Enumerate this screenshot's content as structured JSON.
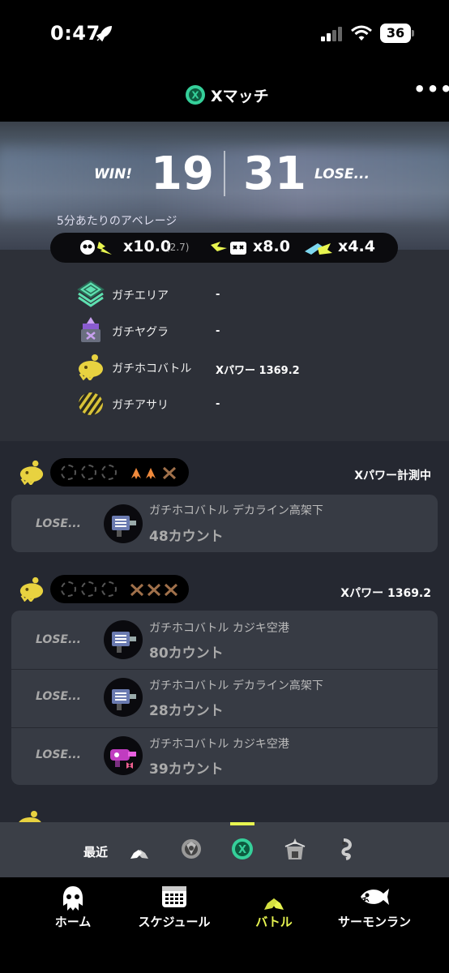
{
  "status_bar": {
    "time": "0:47",
    "battery": "36"
  },
  "header": {
    "title": "Xマッチ",
    "more_label": "•••"
  },
  "score": {
    "win_label": "WIN!",
    "win": "19",
    "lose": "31",
    "lose_label": "LOSE...",
    "average_label": "5分あたりのアベレージ"
  },
  "stats": {
    "kills": "x10.0",
    "assists": "(2.7)",
    "deaths": "x8.0",
    "specials": "x4.4"
  },
  "modes": [
    {
      "label": "ガチエリア",
      "value": "-"
    },
    {
      "label": "ガチヤグラ",
      "value": "-"
    },
    {
      "label": "ガチホコバトル",
      "value": "Xパワー 1369.2"
    },
    {
      "label": "ガチアサリ",
      "value": "-"
    }
  ],
  "groups": [
    {
      "status": "Xパワー計測中",
      "matches": [
        {
          "result": "LOSE...",
          "stage": "ガチホコバトル デカライン高架下",
          "count": "48カウント"
        }
      ]
    },
    {
      "status": "Xパワー 1369.2",
      "matches": [
        {
          "result": "LOSE...",
          "stage": "ガチホコバトル カジキ空港",
          "count": "80カウント"
        },
        {
          "result": "LOSE...",
          "stage": "ガチホコバトル デカライン高架下",
          "count": "28カウント"
        },
        {
          "result": "LOSE...",
          "stage": "ガチホコバトル カジキ空港",
          "count": "39カウント"
        }
      ]
    }
  ],
  "filter": {
    "label": "最近"
  },
  "tabs": [
    {
      "label": "ホーム"
    },
    {
      "label": "スケジュール"
    },
    {
      "label": "バトル"
    },
    {
      "label": "サーモンラン"
    }
  ],
  "colors": {
    "accent_yellow": "#e8f550",
    "x_green": "#35d09a",
    "win_arrow": "#f08a3c"
  }
}
